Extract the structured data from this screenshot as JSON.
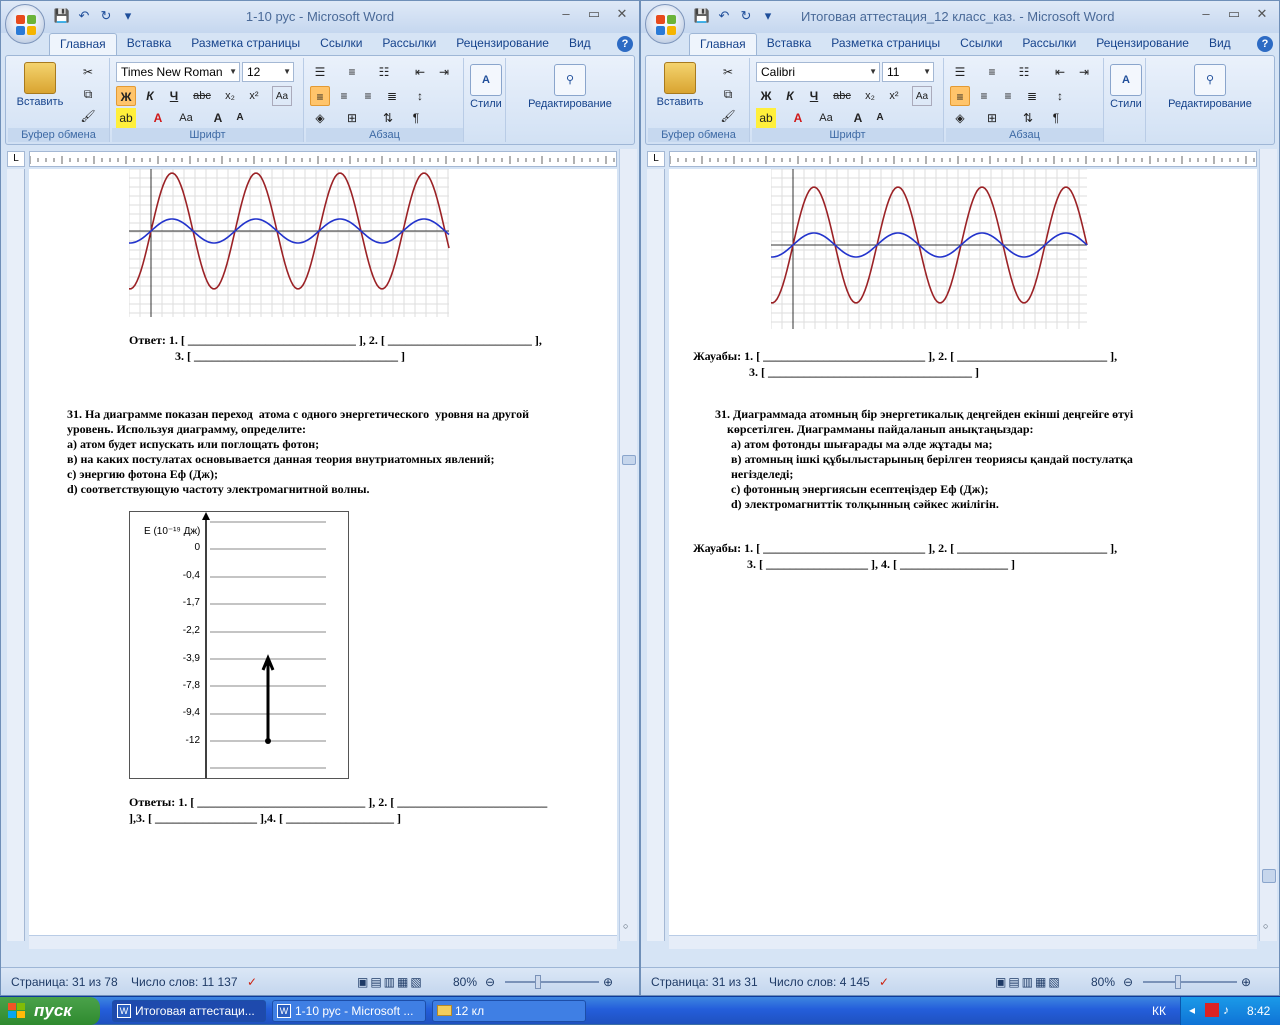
{
  "left": {
    "title": "1-10 рус - Microsoft Word",
    "tabs": [
      "Главная",
      "Вставка",
      "Разметка страницы",
      "Ссылки",
      "Рассылки",
      "Рецензирование",
      "Вид"
    ],
    "font_name": "Times New Roman",
    "font_size": "12",
    "groups": {
      "clipboard": "Буфер обмена",
      "font": "Шрифт",
      "paragraph": "Абзац"
    },
    "paste_label": "Вставить",
    "styles_label": "Стили",
    "edit_label": "Редактирование",
    "status": {
      "page": "Страница: 31 из 78",
      "words": "Число слов: 11 137",
      "zoom": "80%"
    },
    "answer1_a": "Ответ: 1. [ ____________________________ ], 2. [ ________________________ ],",
    "answer1_b": "3. [ __________________________________ ]",
    "q31": [
      "31. На диаграмме показан переход  атома с одного энергетического  уровня на другой",
      "уровень. Используя диаграмму, определите:",
      "а) атом будет испускать или поглощать фотон;",
      "в) на каких постулатах основывается данная теория внутриатомных явлений;",
      "с) энергию фотона Еф (Дж);",
      "d) соответствующую частоту электромагнитной волны."
    ],
    "diagram_axis": "E (10⁻¹⁹ Дж)",
    "levels": [
      "0",
      "-0,4",
      "-1,7",
      "-2,2",
      "-3,9",
      "-7,8",
      "-9,4",
      "-12"
    ],
    "answer2_a": "Ответы: 1. [ ____________________________ ], 2. [ _________________________",
    "answer2_b": "],3. [ _________________ ],4. [ __________________ ]"
  },
  "right": {
    "title": "Итоговая аттестация_12 класс_каз. - Microsoft Word",
    "tabs": [
      "Главная",
      "Вставка",
      "Разметка страницы",
      "Ссылки",
      "Рассылки",
      "Рецензирование",
      "Вид"
    ],
    "font_name": "Calibri",
    "font_size": "11",
    "groups": {
      "clipboard": "Буфер обмена",
      "font": "Шрифт",
      "paragraph": "Абзац"
    },
    "paste_label": "Вставить",
    "styles_label": "Стили",
    "edit_label": "Редактирование",
    "status": {
      "page": "Страница: 31 из 31",
      "words": "Число слов: 4 145",
      "zoom": "80%"
    },
    "answer1_a": "Жауабы: 1. [ ___________________________ ], 2. [ _________________________ ],",
    "answer1_b": "3. [ __________________________________ ]",
    "q31": [
      "31. Диаграммада атомның бір энергетикалық деңгейден екінші деңгейге өтуі",
      "    көрсетілген. Диаграмманы пайдаланып анықтаңыздар:",
      "а) атом фотонды шығарады ма әлде жұтады ма;",
      "в) атомның ішкі құбылыстарының берілген теориясы қандай постулатқа",
      "негізделеді;",
      "с) фотонның энергиясын есептеңіздер Еф (Дж);",
      "d) электромагниттік толқынның сәйкес жиілігін."
    ],
    "answer2_a": "Жауабы: 1. [ ___________________________ ], 2. [ _________________________ ],",
    "answer2_b": "3. [ _________________ ], 4. [ __________________ ]"
  },
  "taskbar": {
    "start": "пуск",
    "items": [
      "Итоговая аттестаци...",
      "1-10 рус - Microsoft ...",
      "12 кл"
    ],
    "lang": "КК",
    "clock": "8:42"
  },
  "colors": {
    "wave_red": "#9b2226",
    "wave_blue": "#2233cc",
    "accent": "#15428b"
  }
}
